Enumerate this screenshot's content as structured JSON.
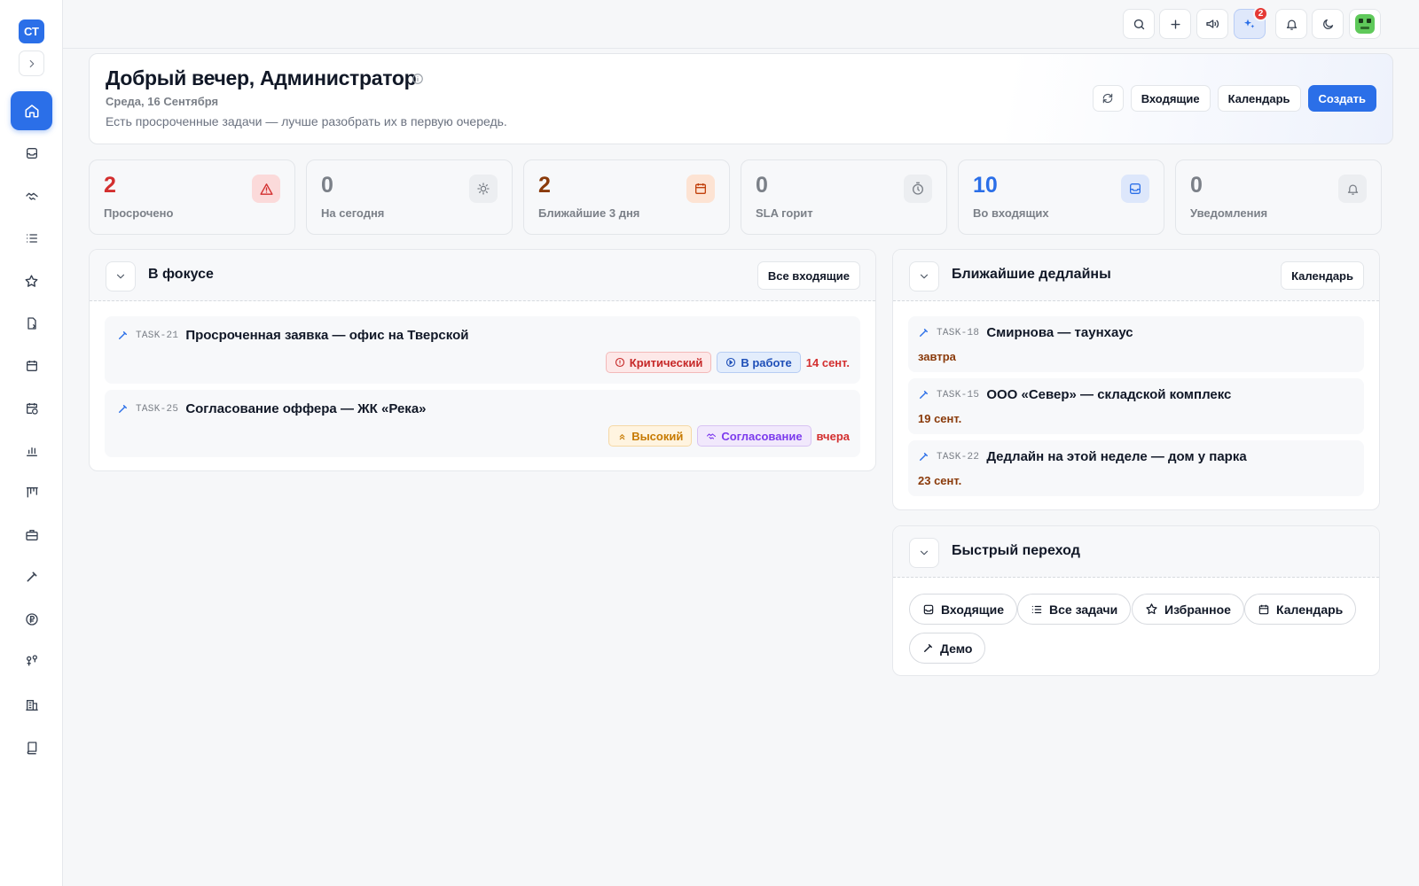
{
  "sidebar": {
    "brand": "СТ",
    "items": [
      {
        "icon": "home-icon",
        "active": true
      },
      {
        "icon": "inbox-icon"
      },
      {
        "icon": "handshake-icon"
      },
      {
        "icon": "list-icon"
      },
      {
        "icon": "star-icon"
      },
      {
        "icon": "document-icon"
      },
      {
        "icon": "calendar-icon"
      },
      {
        "icon": "calendar-clock-icon"
      },
      {
        "icon": "bar-chart-icon"
      },
      {
        "icon": "kanban-icon"
      },
      {
        "icon": "briefcase-icon"
      },
      {
        "icon": "wrench-icon"
      },
      {
        "icon": "ruble-icon"
      },
      {
        "icon": "users-icon"
      },
      {
        "icon": "building-icon"
      },
      {
        "icon": "book-icon"
      }
    ]
  },
  "topbar": {
    "buttons": [
      "search-icon",
      "plus-icon",
      "megaphone-icon",
      "sparkles-icon",
      "bell-icon",
      "moon-icon",
      "avatar"
    ],
    "ai_badge": "2"
  },
  "hero": {
    "title": "Добрый вечер, Администратор",
    "date": "Среда, 16 Сентября",
    "subtitle": "Есть просроченные задачи — лучше разобрать их в первую очередь.",
    "inbox_label": "Входящие",
    "calendar_label": "Календарь",
    "create_label": "Создать"
  },
  "stats": [
    {
      "value": "2",
      "label": "Просрочено",
      "icon": "warning-icon",
      "color": "#d32f2f"
    },
    {
      "value": "0",
      "label": "На сегодня",
      "icon": "sun-icon",
      "color": "#7b8088"
    },
    {
      "value": "2",
      "label": "Ближайшие 3 дня",
      "icon": "calendar-icon",
      "color": "#8a3a0a"
    },
    {
      "value": "0",
      "label": "SLA горит",
      "icon": "timer-icon",
      "color": "#7b8088"
    },
    {
      "value": "10",
      "label": "Во входящих",
      "icon": "inbox-icon",
      "color": "#2b6fe8"
    },
    {
      "value": "0",
      "label": "Уведомления",
      "icon": "bell-icon",
      "color": "#7b8088"
    }
  ],
  "focus": {
    "title": "В фокусе",
    "button": "Все входящие",
    "tasks": [
      {
        "key": "TASK-21",
        "title": "Просроченная заявка — офис на Тверской",
        "priority": "Критический",
        "status": "В работе",
        "due": "14 сент."
      },
      {
        "key": "TASK-25",
        "title": "Согласование оффера — ЖК «Река»",
        "priority": "Высокий",
        "status": "Согласование",
        "due": "вчера"
      }
    ]
  },
  "deadlines": {
    "title": "Ближайшие дедлайны",
    "button": "Календарь",
    "items": [
      {
        "key": "TASK-18",
        "title": "Смирнова — таунхаус",
        "date": "завтра"
      },
      {
        "key": "TASK-15",
        "title": "ООО «Север» — складской комплекс",
        "date": "19 сент."
      },
      {
        "key": "TASK-22",
        "title": "Дедлайн на этой неделе — дом у парка",
        "date": "23 сент."
      }
    ]
  },
  "quick": {
    "title": "Быстрый переход",
    "links": [
      {
        "label": "Входящие",
        "icon": "inbox-icon"
      },
      {
        "label": "Все задачи",
        "icon": "list-icon"
      },
      {
        "label": "Избранное",
        "icon": "star-icon"
      },
      {
        "label": "Календарь",
        "icon": "calendar-icon"
      },
      {
        "label": "Демо",
        "icon": "wrench-icon"
      }
    ]
  }
}
